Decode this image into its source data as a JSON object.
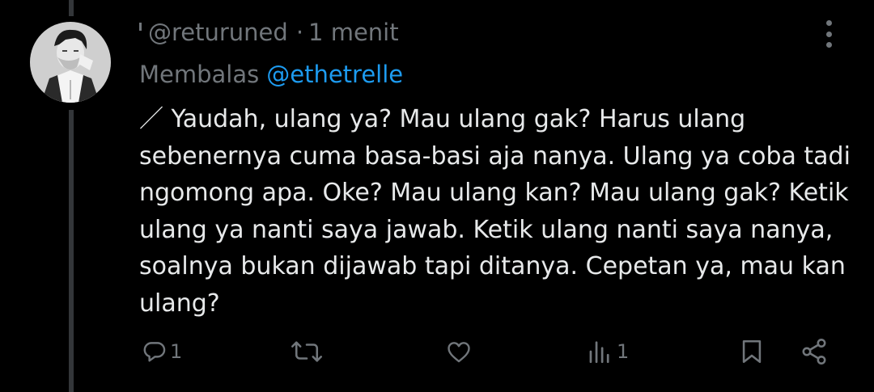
{
  "post": {
    "handle": "@returuned",
    "separator": "·",
    "time": "1 menit",
    "reply_prefix": "Membalas",
    "reply_mention": "@ethetrelle",
    "text_lines": [
      "／ Yaudah, ulang ya? Mau ulang gak? Harus ulang",
      "sebenernya cuma basa-basi aja nanya. Ulang ya coba tadi",
      "ngomong apa. Oke? Mau ulang kan? Mau ulang gak? Ketik",
      "ulang ya nanti saya jawab. Ketik ulang nanti saya nanya,",
      "soalnya bukan dijawab tapi ditanya. Cepetan ya, mau kan",
      "ulang?"
    ]
  },
  "actions": {
    "reply_icon": "reply-icon",
    "reply_count": "1",
    "repost_icon": "repost-icon",
    "like_icon": "like-icon",
    "views_icon": "views-icon",
    "views_count": "1",
    "bookmark_icon": "bookmark-icon",
    "share_icon": "share-icon",
    "more_icon": "more-vertical-icon"
  },
  "colors": {
    "background": "#000000",
    "text_primary": "#e7e9ea",
    "text_secondary": "#71767b",
    "accent": "#1d9bf0",
    "thread_line": "#333639"
  }
}
